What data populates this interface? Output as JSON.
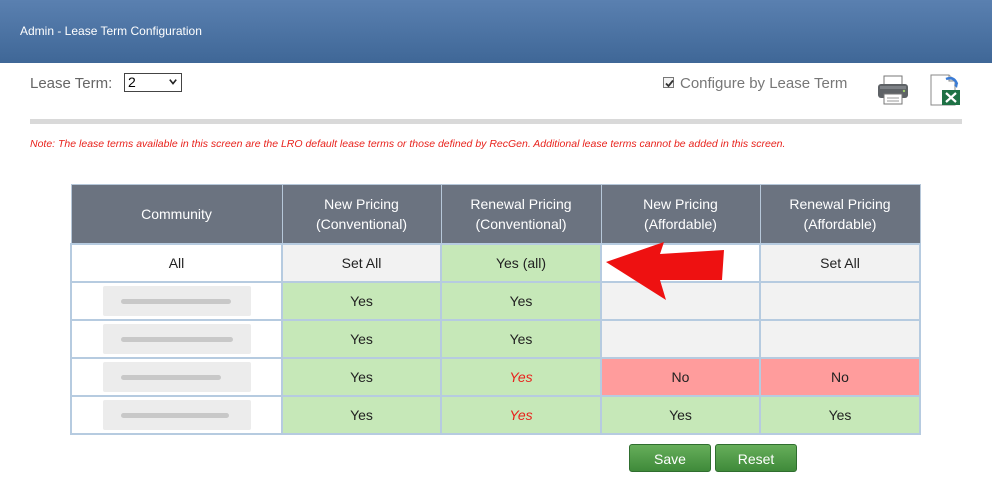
{
  "header": {
    "title": "Admin - Lease Term Configuration"
  },
  "lease_term": {
    "label": "Lease Term:",
    "selected": "2"
  },
  "configure": {
    "label": "Configure by Lease Term",
    "checked": true
  },
  "icons": {
    "print": "printer-icon",
    "export": "excel-export-icon"
  },
  "note": "Note: The lease terms available in this screen are the LRO default lease terms or those defined by RecGen. Additional lease terms cannot be added in this screen.",
  "table": {
    "headers": [
      {
        "line1": "Community",
        "line2": ""
      },
      {
        "line1": "New Pricing",
        "line2": "(Conventional)"
      },
      {
        "line1": "Renewal Pricing",
        "line2": "(Conventional)"
      },
      {
        "line1": "New Pricing",
        "line2": "(Affordable)"
      },
      {
        "line1": "Renewal Pricing",
        "line2": "(Affordable)"
      }
    ],
    "all_row": {
      "community": "All",
      "new_conv": "Set All",
      "renew_conv": "Yes (all)",
      "new_aff": "",
      "renew_aff": "Set All"
    },
    "rows": [
      {
        "new_conv": "Yes",
        "renew_conv": "Yes",
        "new_aff": "",
        "renew_aff": ""
      },
      {
        "new_conv": "Yes",
        "renew_conv": "Yes",
        "new_aff": "",
        "renew_aff": ""
      },
      {
        "new_conv": "Yes",
        "renew_conv": "Yes",
        "new_aff": "No",
        "renew_aff": "No"
      },
      {
        "new_conv": "Yes",
        "renew_conv": "Yes",
        "new_aff": "Yes",
        "renew_aff": "Yes"
      }
    ]
  },
  "buttons": {
    "save": "Save",
    "reset": "Reset"
  },
  "colors": {
    "header": "#4a70a0",
    "note": "#e8231d",
    "yes_green": "#c6e8b8",
    "no_red": "#ff9c9c",
    "button_green": "#4f9a45",
    "arrow": "#ee1111"
  }
}
